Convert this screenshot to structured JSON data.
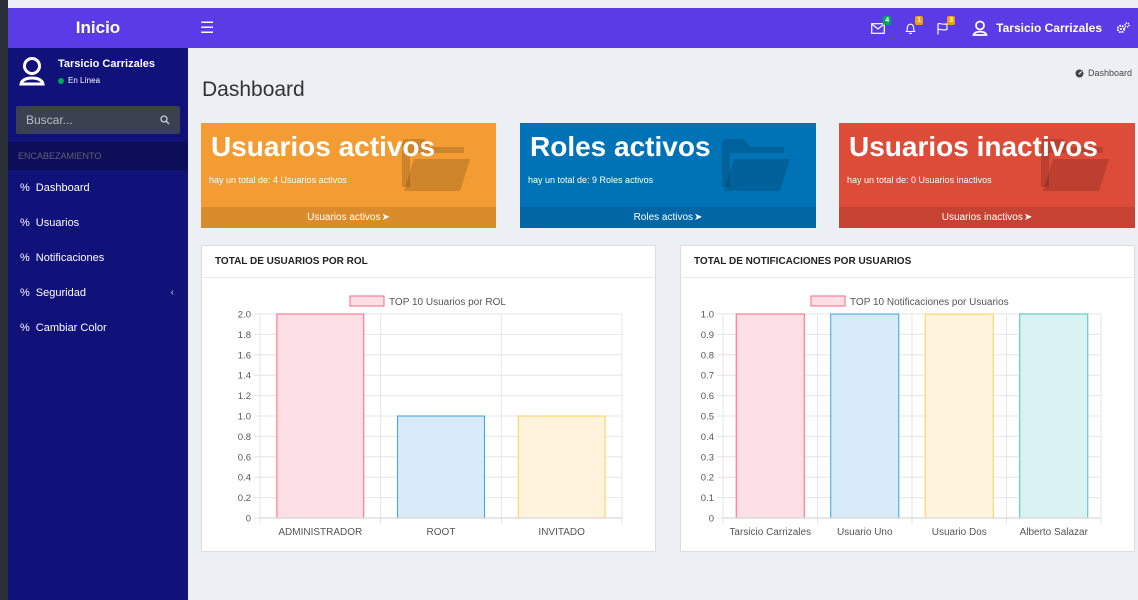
{
  "topbar": {
    "logo": "Inicio",
    "icons": [
      {
        "icon": "envelope-icon",
        "badge": "4",
        "color": "#00a65a"
      },
      {
        "icon": "bell-icon",
        "badge": "1",
        "color": "#f39c12"
      },
      {
        "icon": "flag-icon",
        "badge": "3",
        "color": "#f39c12"
      }
    ],
    "user_name": "Tarsicio Carrizales"
  },
  "sidebar": {
    "user_name": "Tarsicio Carrizales",
    "status": "En Línea",
    "search_placeholder": "Buscar...",
    "header": "ENCABEZAMIENTO",
    "items": [
      {
        "label": "Dashboard"
      },
      {
        "label": "Usuarios"
      },
      {
        "label": "Notificaciones"
      },
      {
        "label": "Seguridad"
      },
      {
        "label": "Cambiar Color"
      }
    ]
  },
  "main": {
    "title": "Dashboard",
    "breadcrumb": "Dashboard",
    "boxes": [
      {
        "title": "Usuarios activos",
        "subtitle": "hay un total de: 4  Usuarios activos",
        "link": "Usuarios activos",
        "color": "#f39c33"
      },
      {
        "title": "Roles activos",
        "subtitle": "hay un total de: 9  Roles activos",
        "link": "Roles activos",
        "color": "#0073b7"
      },
      {
        "title": "Usuarios inactivos",
        "subtitle": "hay un total de: 0  Usuarios inactivos",
        "link": "Usuarios inactivos",
        "color": "#dd4b39"
      }
    ],
    "panels": [
      {
        "title": "TOTAL DE USUARIOS POR ROL"
      },
      {
        "title": "TOTAL DE NOTIFICACIONES POR USUARIOS"
      }
    ]
  },
  "chart_data": [
    {
      "type": "bar",
      "legend": "TOP 10 Usuarios por ROL",
      "categories": [
        "ADMINISTRADOR",
        "ROOT",
        "INVITADO"
      ],
      "values": [
        2,
        1,
        1
      ],
      "ylim": [
        0,
        2.0
      ],
      "yticks": [
        "2.0",
        "1.8",
        "1.6",
        "1.4",
        "1.2",
        "1.0",
        "0.8",
        "0.6",
        "0.4",
        "0.2",
        "0"
      ],
      "colors": [
        {
          "fill": "#fde0e6",
          "stroke": "#ff6384"
        },
        {
          "fill": "#d7ebf8",
          "stroke": "#36a2eb"
        },
        {
          "fill": "#fff3dd",
          "stroke": "#ffce56"
        }
      ],
      "legend_colors": {
        "fill": "#fde0e6",
        "stroke": "#ff6384"
      },
      "grid": true,
      "legend_position": "top"
    },
    {
      "type": "bar",
      "legend": "TOP 10 Notificaciones por Usuarios",
      "categories": [
        "Tarsicio Carrizales",
        "Usuario Uno",
        "Usuario Dos",
        "Alberto Salazar"
      ],
      "values": [
        1,
        1,
        1,
        1
      ],
      "ylim": [
        0,
        1.0
      ],
      "yticks": [
        "1.0",
        "0.9",
        "0.8",
        "0.7",
        "0.6",
        "0.5",
        "0.4",
        "0.3",
        "0.2",
        "0.1",
        "0"
      ],
      "colors": [
        {
          "fill": "#fde0e6",
          "stroke": "#ff6384"
        },
        {
          "fill": "#d7ebf8",
          "stroke": "#36a2eb"
        },
        {
          "fill": "#fff3dd",
          "stroke": "#ffce56"
        },
        {
          "fill": "#dbf2f2",
          "stroke": "#4bc0c0"
        }
      ],
      "legend_colors": {
        "fill": "#fde0e6",
        "stroke": "#ff6384"
      },
      "grid": true,
      "legend_position": "top"
    }
  ]
}
